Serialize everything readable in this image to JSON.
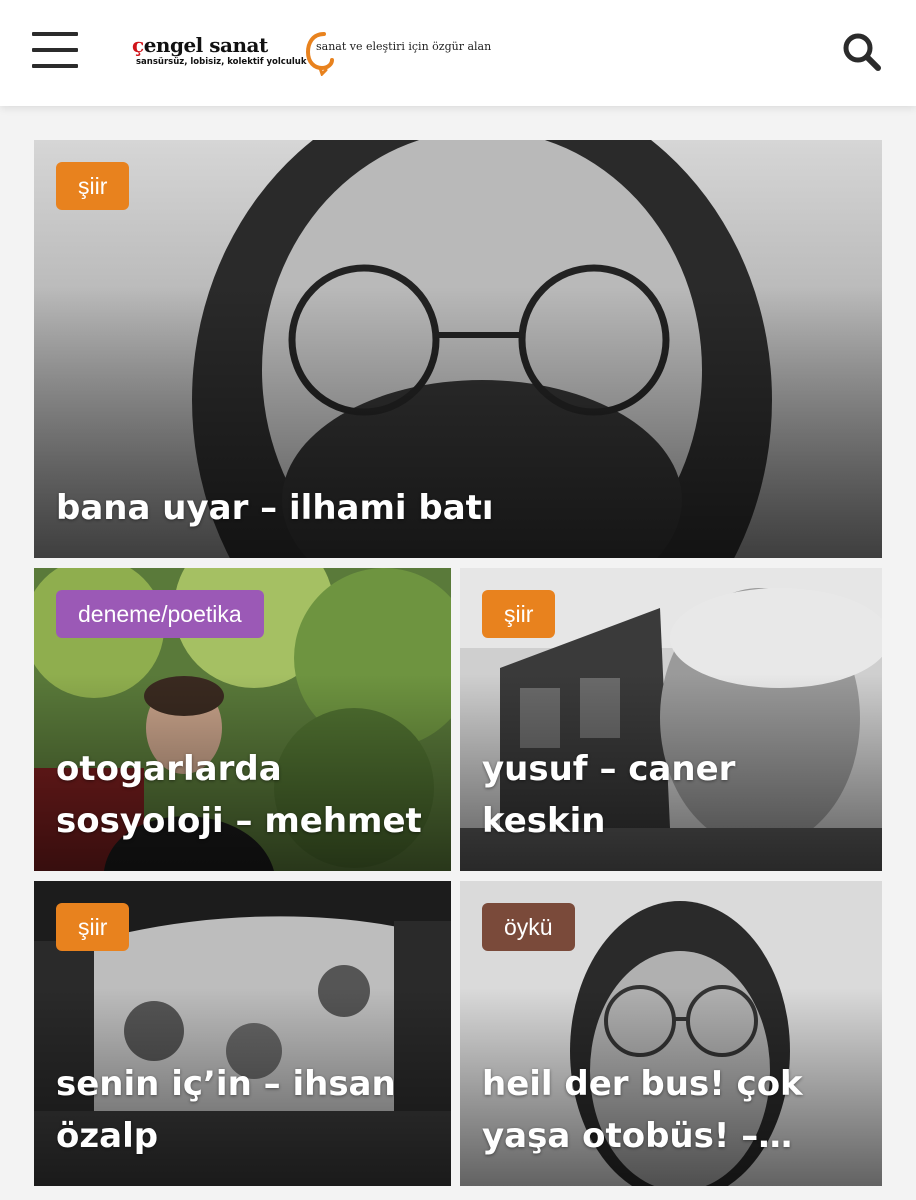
{
  "header": {
    "logo_title": "çengel sanat",
    "logo_subtitle": "sansürsüz, lobisiz, kolektif yolculuk",
    "tagline": "sanat ve eleştiri için özgür alan",
    "accent_color": "#e8821e",
    "icons": {
      "menu": "hamburger-menu-icon",
      "search": "search-icon"
    }
  },
  "posts": [
    {
      "category": "şiir",
      "category_color": "#e8821e",
      "title": "bana uyar – ilhami batı"
    },
    {
      "category": "deneme/poetika",
      "category_color": "#9b59b6",
      "title": "otogarlarda sosyoloji – mehmet"
    },
    {
      "category": "şiir",
      "category_color": "#e8821e",
      "title": "yusuf – caner keskin"
    },
    {
      "category": "şiir",
      "category_color": "#e8821e",
      "title": "senin iç’in – ihsan özalp"
    },
    {
      "category": "öykü",
      "category_color": "#7a4a3a",
      "title": "heil der bus! çok yaşa otobüs! – mert"
    }
  ]
}
